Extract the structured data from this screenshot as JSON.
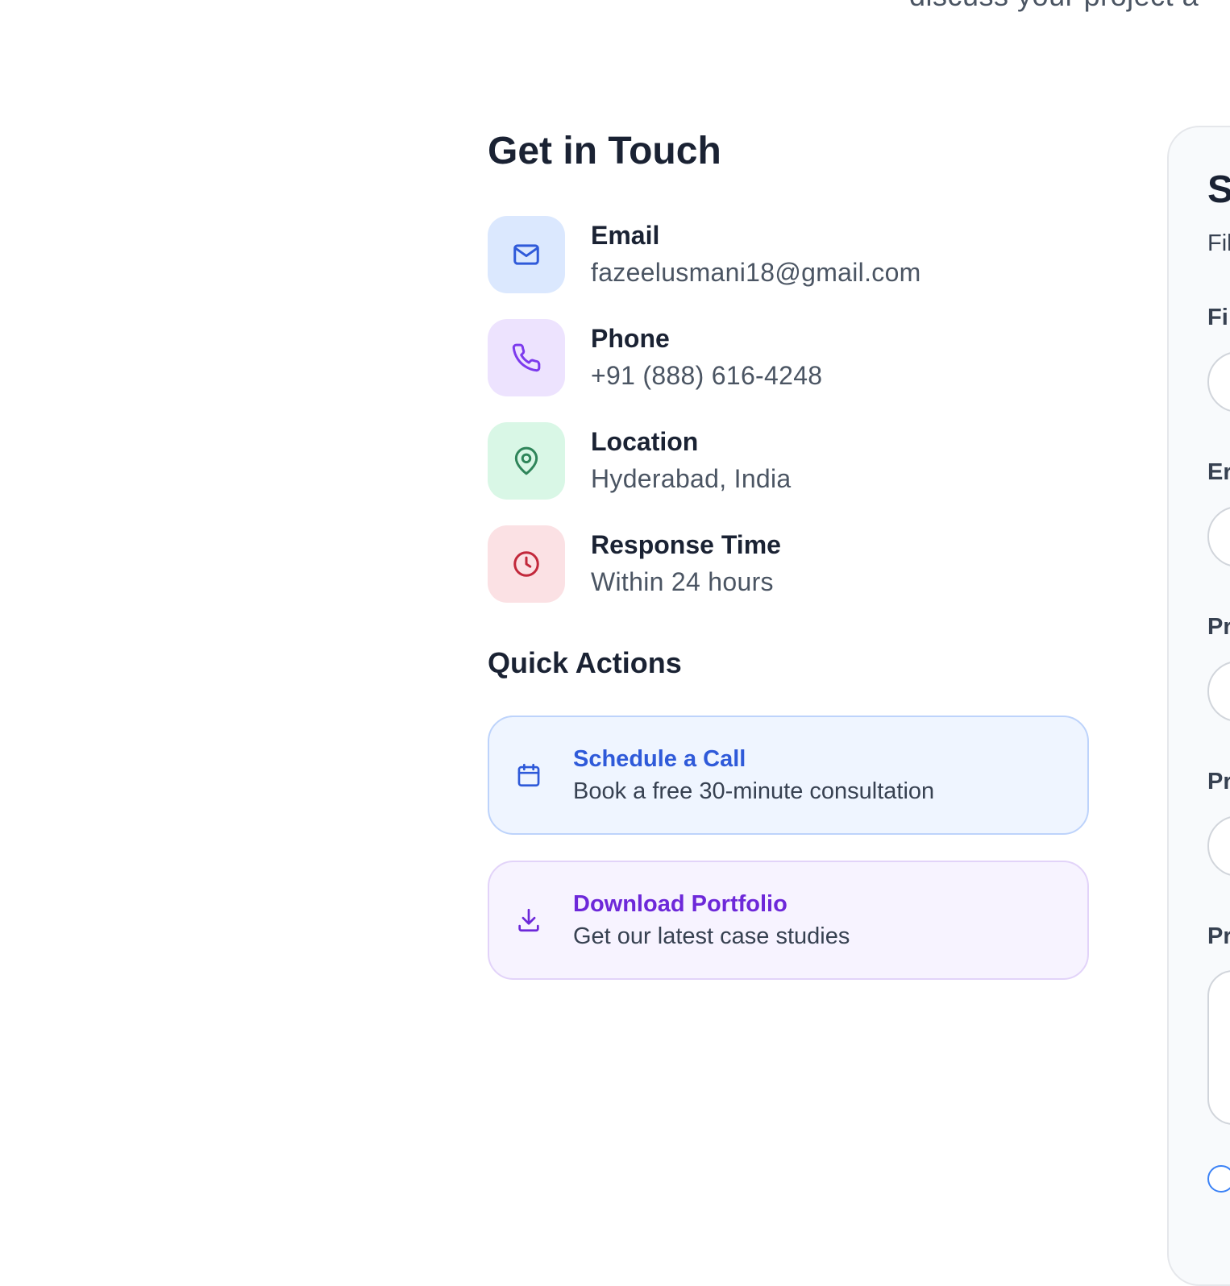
{
  "header": {
    "subtitle_partial": "discuss your project a"
  },
  "contact": {
    "title": "Get in Touch",
    "items": [
      {
        "label": "Email",
        "value": "fazeelusmani18@gmail.com",
        "icon": "mail-icon",
        "bg": "#dbe8fe",
        "color": "#2f5ad9"
      },
      {
        "label": "Phone",
        "value": "+91 (888) 616-4248",
        "icon": "phone-icon",
        "bg": "#ede3fe",
        "color": "#7c3aed"
      },
      {
        "label": "Location",
        "value": "Hyderabad, India",
        "icon": "map-pin-icon",
        "bg": "#d9f7e6",
        "color": "#2f855a"
      },
      {
        "label": "Response Time",
        "value": "Within 24 hours",
        "icon": "clock-icon",
        "bg": "#fbe1e4",
        "color": "#c2283b"
      }
    ]
  },
  "quick_actions": {
    "title": "Quick Actions",
    "items": [
      {
        "title": "Schedule a Call",
        "subtitle": "Book a free 30-minute consultation",
        "icon": "calendar-icon",
        "color": "#2f5ad9"
      },
      {
        "title": "Download Portfolio",
        "subtitle": "Get our latest case studies",
        "icon": "download-icon",
        "color": "#6d28d9"
      }
    ]
  },
  "form_panel": {
    "title_partial": "S",
    "subtitle_partial": "Fil",
    "labels": [
      "Fi",
      "Er",
      "Pr",
      "Pr",
      "Pr"
    ]
  }
}
